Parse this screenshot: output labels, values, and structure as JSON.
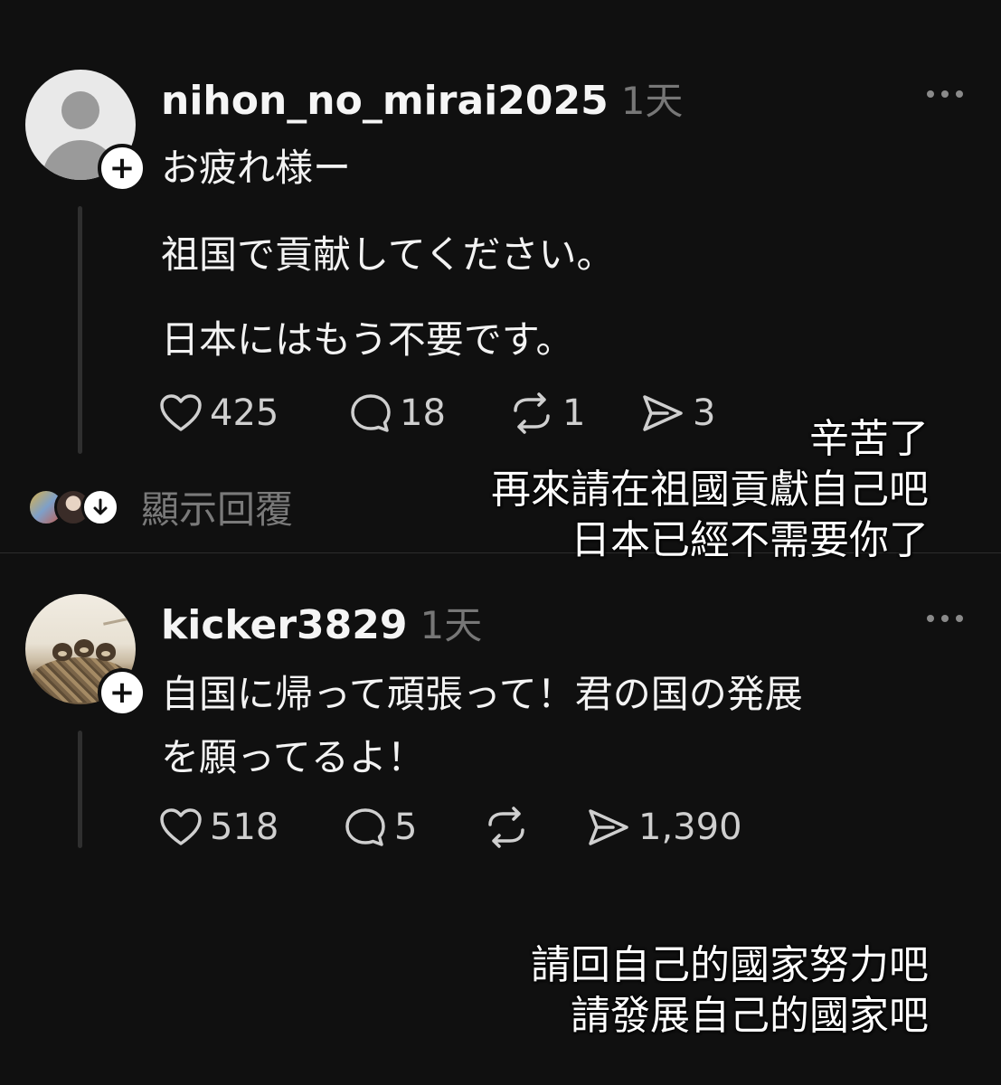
{
  "post1": {
    "username": "nihon_no_mirai2025",
    "time": "1天",
    "lines": [
      "お疲れ様ー",
      "祖国で貢献してください。",
      "日本にはもう不要です。"
    ],
    "likes": "425",
    "comments": "18",
    "reposts": "1",
    "shares": "3",
    "show_replies": "顯示回覆"
  },
  "post2": {
    "username": "kicker3829",
    "time": "1天",
    "lines": [
      "自国に帰って頑張って！君の国の発展",
      "を願ってるよ！"
    ],
    "likes": "518",
    "comments": "5",
    "reposts": "",
    "shares": "1,390"
  },
  "overlay1": [
    "辛苦了",
    "再來請在祖國貢獻自己吧",
    "日本已經不需要你了"
  ],
  "overlay2": [
    "請回自己的國家努力吧",
    "請發展自己的國家吧"
  ],
  "icons": {
    "follow": "plus-icon",
    "like": "heart-icon",
    "comment": "comment-bubble-icon",
    "repost": "repost-icon",
    "share": "send-icon",
    "more": "more-dots-icon",
    "replies": "arrow-down-icon"
  },
  "colors": {
    "background": "#101010",
    "text": "#f3f3f3",
    "muted": "#777777"
  }
}
